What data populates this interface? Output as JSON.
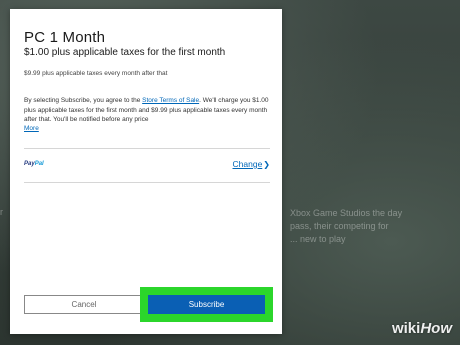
{
  "dialog": {
    "title": "PC 1 Month",
    "subtitle": "$1.00 plus applicable taxes for the first month",
    "after_price": "$9.99 plus applicable taxes every month after that",
    "terms_prefix": "By selecting Subscribe, you agree to the ",
    "terms_link": "Store Terms of Sale",
    "terms_suffix": ". We'll charge you $1.00 plus applicable taxes for the first month and $9.99 plus applicable taxes every month after that. You'll be notified before any price",
    "more_link": "More",
    "payment": {
      "method_brand_1": "Pay",
      "method_brand_2": "Pal",
      "change_link": "Change"
    },
    "cancel_label": "Cancel",
    "subscribe_label": "Subscribe"
  },
  "background": {
    "left_fragment": "r",
    "right_text": "Xbox Game Studios the day\npass, their competing for\n... new to play"
  },
  "watermark": {
    "part1": "wiki",
    "part2": "How"
  },
  "colors": {
    "link": "#0067b8",
    "subscribe_button": "#0a5fb4",
    "highlight": "#2bd62b"
  },
  "icons": [
    "chevron-right-icon",
    "paypal-logo"
  ]
}
